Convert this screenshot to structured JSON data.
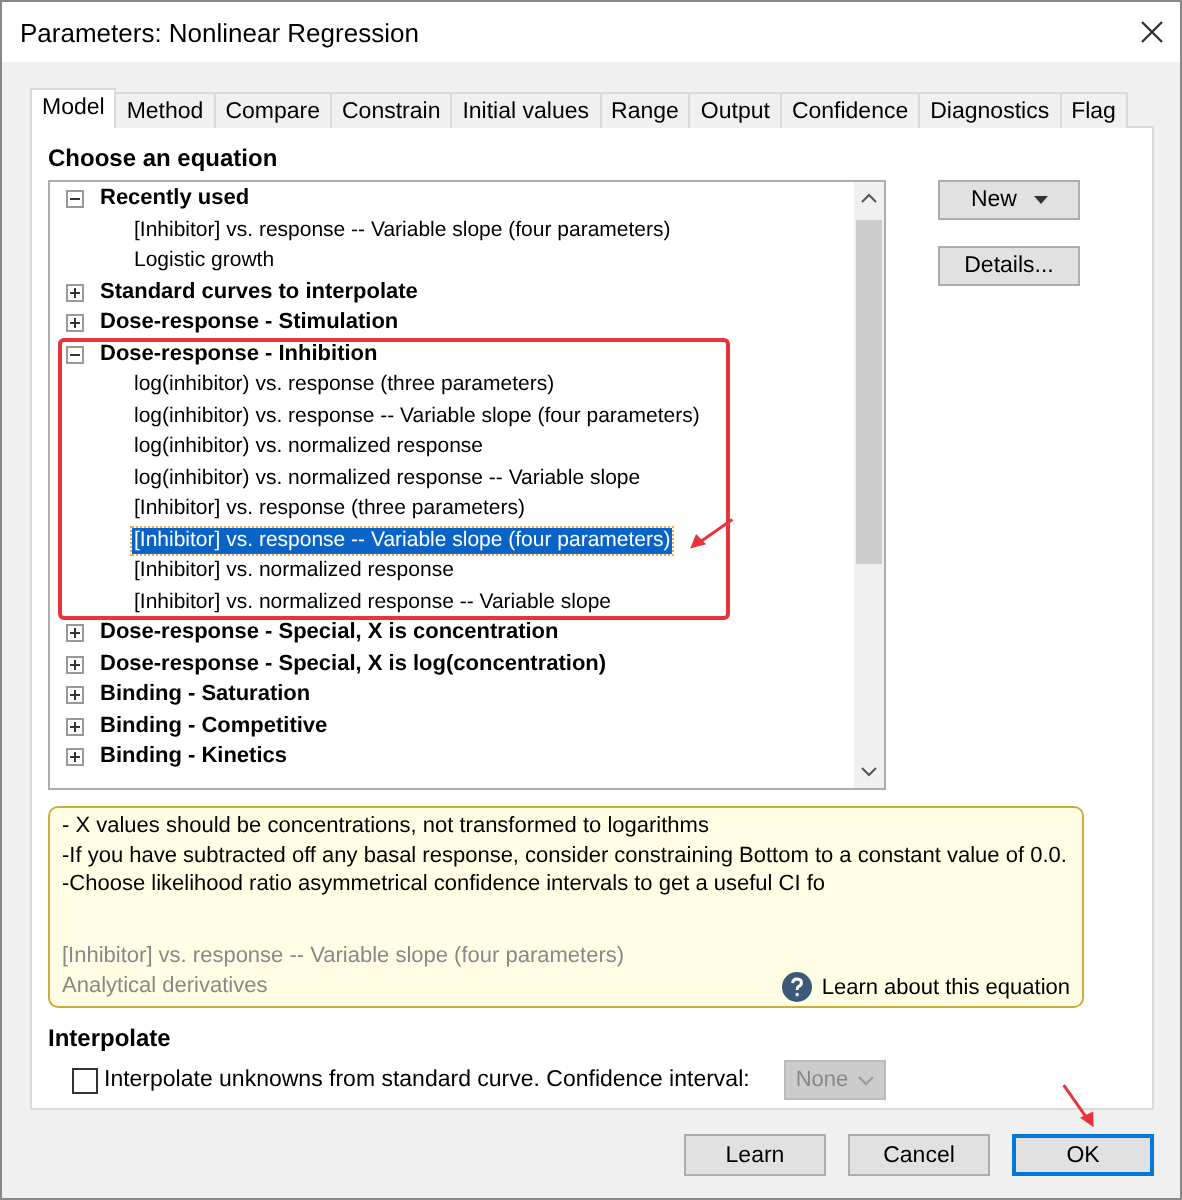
{
  "window": {
    "title": "Parameters: Nonlinear Regression"
  },
  "tabs": [
    {
      "label": "Model",
      "selected": true
    },
    {
      "label": "Method",
      "selected": false
    },
    {
      "label": "Compare",
      "selected": false
    },
    {
      "label": "Constrain",
      "selected": false
    },
    {
      "label": "Initial values",
      "selected": false
    },
    {
      "label": "Range",
      "selected": false
    },
    {
      "label": "Output",
      "selected": false
    },
    {
      "label": "Confidence",
      "selected": false
    },
    {
      "label": "Diagnostics",
      "selected": false
    },
    {
      "label": "Flag",
      "selected": false
    }
  ],
  "equation_section": {
    "heading": "Choose an equation"
  },
  "tree": [
    {
      "label": "Recently used",
      "expanded": true,
      "highlighted": false,
      "children": [
        {
          "label": "[Inhibitor] vs. response -- Variable slope (four parameters)",
          "selected": false,
          "arrow": false
        },
        {
          "label": "Logistic growth",
          "selected": false,
          "arrow": false
        }
      ]
    },
    {
      "label": "Standard curves to interpolate",
      "expanded": false,
      "highlighted": false
    },
    {
      "label": "Dose-response - Stimulation",
      "expanded": false,
      "highlighted": false
    },
    {
      "label": "Dose-response - Inhibition",
      "expanded": true,
      "highlighted": true,
      "children": [
        {
          "label": "log(inhibitor) vs. response (three parameters)",
          "selected": false,
          "arrow": false
        },
        {
          "label": "log(inhibitor) vs. response -- Variable slope (four parameters)",
          "selected": false,
          "arrow": false
        },
        {
          "label": "log(inhibitor) vs. normalized response",
          "selected": false,
          "arrow": false
        },
        {
          "label": "log(inhibitor) vs. normalized response -- Variable slope",
          "selected": false,
          "arrow": false
        },
        {
          "label": "[Inhibitor] vs. response (three parameters)",
          "selected": false,
          "arrow": false
        },
        {
          "label": "[Inhibitor] vs. response -- Variable slope (four parameters)",
          "selected": true,
          "arrow": true
        },
        {
          "label": "[Inhibitor] vs. normalized response",
          "selected": false,
          "arrow": false
        },
        {
          "label": "[Inhibitor] vs. normalized response -- Variable slope",
          "selected": false,
          "arrow": false
        }
      ]
    },
    {
      "label": "Dose-response - Special, X is concentration",
      "expanded": false,
      "highlighted": false
    },
    {
      "label": "Dose-response - Special, X is log(concentration)",
      "expanded": false,
      "highlighted": false
    },
    {
      "label": "Binding - Saturation",
      "expanded": false,
      "highlighted": false
    },
    {
      "label": "Binding - Competitive",
      "expanded": false,
      "highlighted": false
    },
    {
      "label": "Binding - Kinetics",
      "expanded": false,
      "highlighted": false
    }
  ],
  "side_buttons": [
    {
      "label": "New",
      "kind": "dropdown"
    },
    {
      "label": "Details...",
      "kind": "plain"
    }
  ],
  "info": {
    "notes": [
      "- X values should be concentrations, not transformed to logarithms",
      "-If you have subtracted off any  basal response, consider constraining Bottom to a constant value of 0.0.",
      "-Choose likelihood ratio asymmetrical confidence intervals to get a useful CI fo"
    ],
    "equation": "[Inhibitor] vs. response -- Variable slope (four parameters)",
    "method": "Analytical derivatives",
    "help_link": "Learn about this equation"
  },
  "interpolate": {
    "heading": "Interpolate",
    "label": "Interpolate unknowns from standard curve. Confidence interval:",
    "checked": false,
    "confidence": "None",
    "disabled": true
  },
  "buttons": [
    {
      "label": "Learn",
      "default": false,
      "arrow": false
    },
    {
      "label": "Cancel",
      "default": false,
      "arrow": false
    },
    {
      "label": "OK",
      "default": true,
      "arrow": true
    }
  ]
}
